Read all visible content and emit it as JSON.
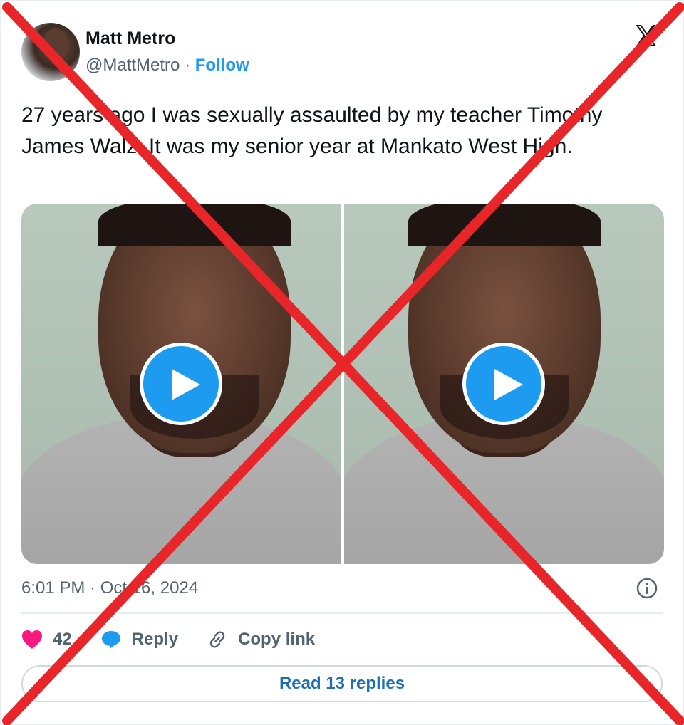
{
  "tweet": {
    "author": {
      "name": "Matt Metro",
      "handle": "@MattMetro",
      "separator": "·",
      "follow_label": "Follow"
    },
    "text": "27 years ago I was sexually assaulted by my teacher Timothy James Walz. It was my senior year at Mankato West High.",
    "media": [
      {
        "type": "video"
      },
      {
        "type": "video"
      }
    ],
    "timestamp": "6:01 PM · Oct 16, 2024",
    "actions": {
      "like_count": "42",
      "reply_label": "Reply",
      "copy_link_label": "Copy link"
    },
    "read_replies_label": "Read 13 replies"
  },
  "colors": {
    "accent": "#1d9bf0",
    "like": "#f91880",
    "overlay_x": "#e8262a",
    "text": "#0f1419",
    "secondary_text": "#536471"
  },
  "icons": {
    "logo": "x-logo-icon",
    "play": "play-icon",
    "info": "info-icon",
    "like": "heart-icon",
    "reply": "speech-bubble-icon",
    "copy": "link-icon"
  }
}
